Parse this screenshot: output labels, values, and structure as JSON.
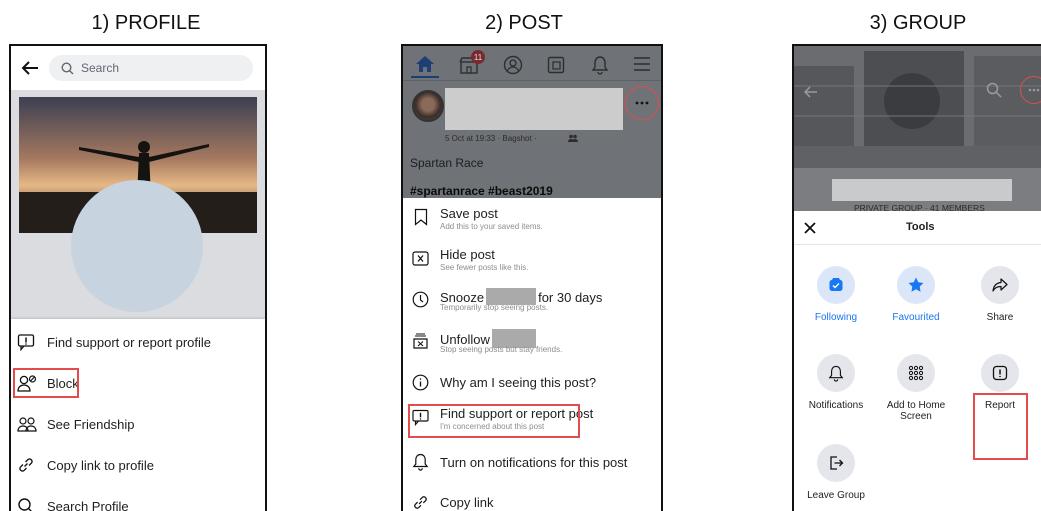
{
  "captions": {
    "profile": "1) PROFILE",
    "post": "2) POST",
    "group": "3) GROUP"
  },
  "profile": {
    "search_placeholder": "Search",
    "menu": [
      {
        "label": "Find support or report profile",
        "icon": "report-flag-icon"
      },
      {
        "label": "Block",
        "icon": "block-user-icon"
      },
      {
        "label": "See Friendship",
        "icon": "friends-icon"
      },
      {
        "label": "Copy link to profile",
        "icon": "link-icon"
      },
      {
        "label": "Search Profile",
        "icon": "search-icon"
      }
    ]
  },
  "post": {
    "notification_count": "11",
    "meta": "5 Oct at 19:33 · Bagshot ·",
    "text": "Spartan Race",
    "hashtags": "#spartanrace #beast2019",
    "menu": [
      {
        "title": "Save post",
        "sub": "Add this to your saved items."
      },
      {
        "title": "Hide post",
        "sub": "See fewer posts like this."
      },
      {
        "title": "Snooze",
        "title_after": "for 30 days",
        "sub": "Temporarily stop seeing posts."
      },
      {
        "title": "Unfollow",
        "sub": "Stop seeing posts but stay friends."
      },
      {
        "title": "Why am I seeing this post?"
      },
      {
        "title": "Find support or report post",
        "sub": "I'm concerned about this post"
      },
      {
        "title": "Turn on notifications for this post"
      },
      {
        "title": "Copy link"
      }
    ]
  },
  "group": {
    "banner_text": "PRIVATE GROUP · 41 MEMBERS",
    "sheet_title": "Tools",
    "tools": [
      {
        "label": "Following",
        "icon": "following-icon",
        "highlight": true
      },
      {
        "label": "Favourited",
        "icon": "star-icon",
        "highlight": true
      },
      {
        "label": "Share",
        "icon": "share-icon"
      },
      {
        "label": "Notifications",
        "icon": "bell-icon"
      },
      {
        "label": "Add to Home Screen",
        "icon": "grid-dots-icon"
      },
      {
        "label": "Report",
        "icon": "report-flag-icon"
      },
      {
        "label": "Leave Group",
        "icon": "leave-icon"
      }
    ],
    "accent": "#1877f2"
  }
}
